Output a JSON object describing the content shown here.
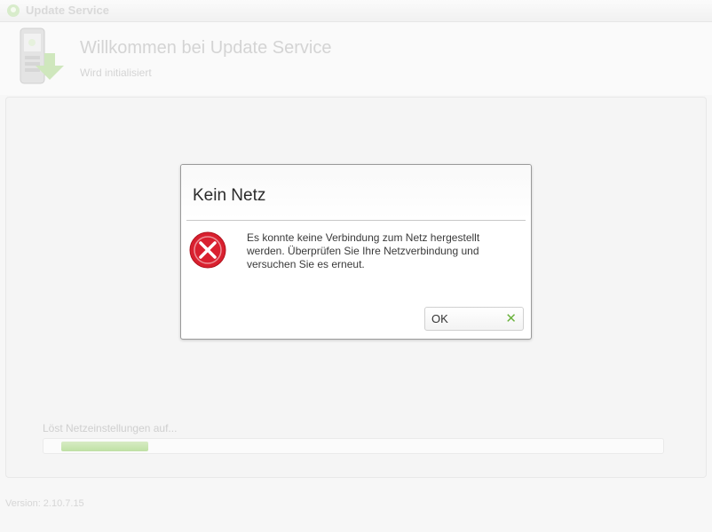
{
  "window": {
    "title": "Update Service",
    "icon": "app-logo-icon"
  },
  "header": {
    "title": "Willkommen bei Update Service",
    "subtitle": "Wird initialisiert",
    "graphic": "phone-download-icon"
  },
  "status": {
    "text": "Löst Netzeinstellungen auf...",
    "progress_fraction": 0.14
  },
  "footer": {
    "version": "Version: 2.10.7.15"
  },
  "dialog": {
    "title": "Kein Netz",
    "message": "Es konnte keine Verbindung zum Netz hergestellt werden. Überprüfen Sie Ihre Netzverbindung und versuchen Sie es erneut.",
    "icon": "error-icon",
    "ok_label": "OK",
    "ok_icon": "check-icon",
    "colors": {
      "error_red": "#d9202f",
      "ok_check_green": "#6cb33f"
    }
  }
}
